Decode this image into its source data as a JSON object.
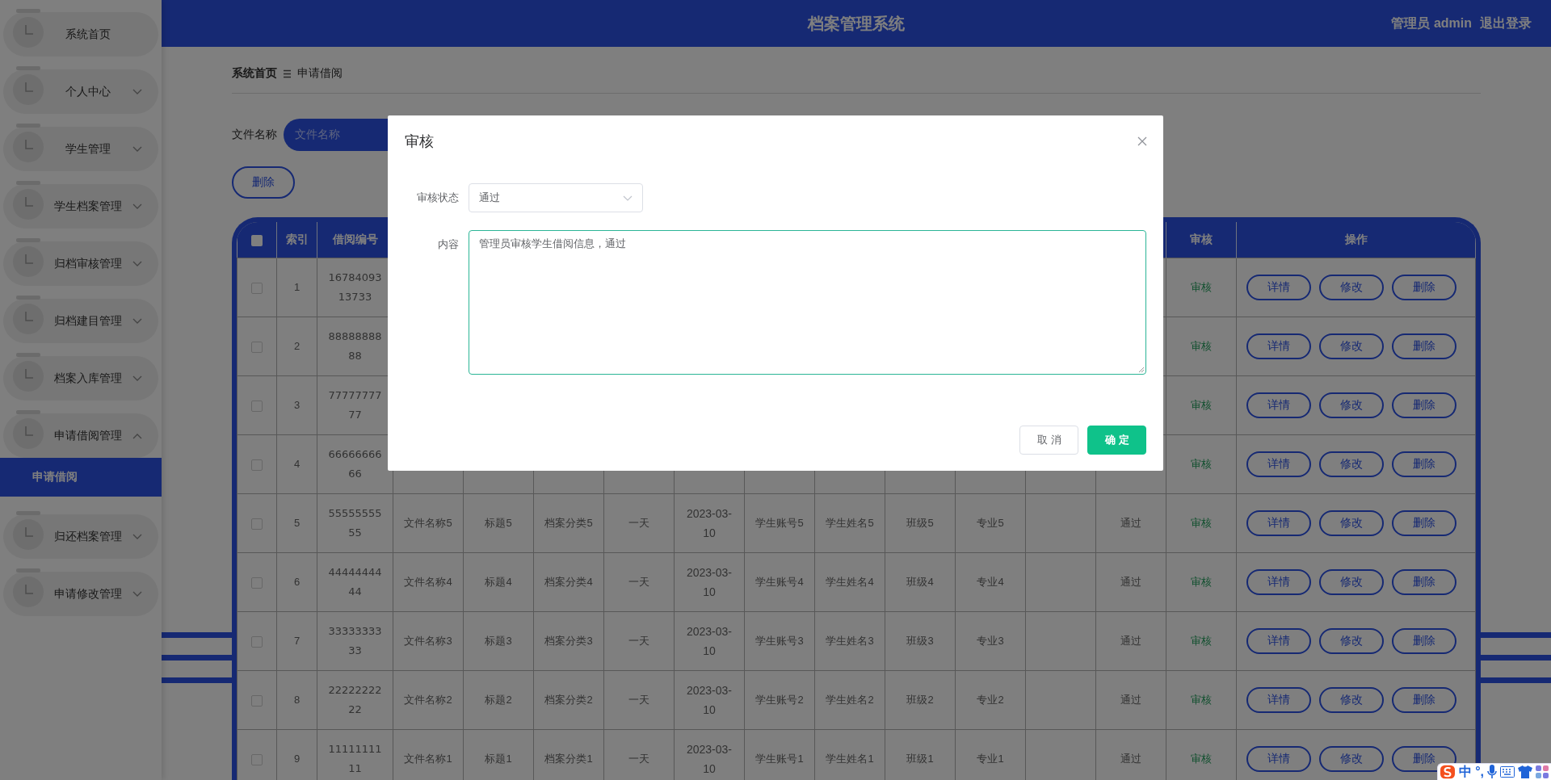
{
  "sidebar": {
    "items": [
      {
        "label": "系统首页",
        "has_children": false,
        "expanded": false
      },
      {
        "label": "个人中心",
        "has_children": true,
        "expanded": false
      },
      {
        "label": "学生管理",
        "has_children": true,
        "expanded": false
      },
      {
        "label": "学生档案管理",
        "has_children": true,
        "expanded": false
      },
      {
        "label": "归档审核管理",
        "has_children": true,
        "expanded": false
      },
      {
        "label": "归档建目管理",
        "has_children": true,
        "expanded": false
      },
      {
        "label": "档案入库管理",
        "has_children": true,
        "expanded": false
      },
      {
        "label": "申请借阅管理",
        "has_children": true,
        "expanded": true,
        "children": [
          {
            "label": "申请借阅",
            "selected": true
          }
        ]
      },
      {
        "label": "归还档案管理",
        "has_children": true,
        "expanded": false
      },
      {
        "label": "申请修改管理",
        "has_children": true,
        "expanded": false
      }
    ]
  },
  "header": {
    "title": "档案管理系统",
    "user": "管理员 admin",
    "logout": "退出登录"
  },
  "breadcrumb": [
    {
      "label": "系统首页",
      "current": false
    },
    {
      "label": "申请借阅",
      "current": true
    }
  ],
  "search": {
    "label": "文件名称",
    "placeholder": "文件名称"
  },
  "toolbar": {
    "delete_button": "删除"
  },
  "table": {
    "select_all": {
      "checked": false
    },
    "headers": {
      "index": "索引",
      "number": "借阅编号",
      "review": "审核",
      "actions": "操作"
    },
    "rows": [
      {
        "checked": false,
        "index": "1",
        "number": "1678409313733",
        "review": "审核",
        "actions": [
          "详情",
          "修改",
          "删除"
        ]
      },
      {
        "checked": false,
        "index": "2",
        "number": "8888888888",
        "review": "审核",
        "actions": [
          "详情",
          "修改",
          "删除"
        ]
      },
      {
        "checked": false,
        "index": "3",
        "number": "7777777777",
        "review": "审核",
        "actions": [
          "详情",
          "修改",
          "删除"
        ]
      },
      {
        "checked": false,
        "index": "4",
        "number": "6666666666",
        "review": "审核",
        "actions": [
          "详情",
          "修改",
          "删除"
        ]
      },
      {
        "checked": false,
        "index": "5",
        "number": "5555555555",
        "file_name": "文件名称5",
        "title": "标题5",
        "category": "档案分类5",
        "duration": "一天",
        "date": "2023-03-10",
        "account": "学生账号5",
        "student_name": "学生姓名5",
        "class": "班级5",
        "major": "专业5",
        "status": "通过",
        "review": "审核",
        "actions": [
          "详情",
          "修改",
          "删除"
        ]
      },
      {
        "checked": false,
        "index": "6",
        "number": "4444444444",
        "file_name": "文件名称4",
        "title": "标题4",
        "category": "档案分类4",
        "duration": "一天",
        "date": "2023-03-10",
        "account": "学生账号4",
        "student_name": "学生姓名4",
        "class": "班级4",
        "major": "专业4",
        "status": "通过",
        "review": "审核",
        "actions": [
          "详情",
          "修改",
          "删除"
        ]
      },
      {
        "checked": false,
        "index": "7",
        "number": "3333333333",
        "file_name": "文件名称3",
        "title": "标题3",
        "category": "档案分类3",
        "duration": "一天",
        "date": "2023-03-10",
        "account": "学生账号3",
        "student_name": "学生姓名3",
        "class": "班级3",
        "major": "专业3",
        "status": "通过",
        "review": "审核",
        "actions": [
          "详情",
          "修改",
          "删除"
        ]
      },
      {
        "checked": false,
        "index": "8",
        "number": "2222222222",
        "file_name": "文件名称2",
        "title": "标题2",
        "category": "档案分类2",
        "duration": "一天",
        "date": "2023-03-10",
        "account": "学生账号2",
        "student_name": "学生姓名2",
        "class": "班级2",
        "major": "专业2",
        "status": "通过",
        "review": "审核",
        "actions": [
          "详情",
          "修改",
          "删除"
        ]
      },
      {
        "checked": false,
        "index": "9",
        "number": "1111111111",
        "file_name": "文件名称1",
        "title": "标题1",
        "category": "档案分类1",
        "duration": "一天",
        "date": "2023-03-10",
        "account": "学生账号1",
        "student_name": "学生姓名1",
        "class": "班级1",
        "major": "专业1",
        "status": "通过",
        "review": "审核",
        "actions": [
          "详情",
          "修改",
          "删除"
        ]
      }
    ]
  },
  "dialog": {
    "title": "审核",
    "fields": [
      {
        "kind": "select",
        "label": "审核状态",
        "value": "通过",
        "focused": false
      },
      {
        "kind": "textarea",
        "label": "内容",
        "value": "管理员审核学生借阅信息，通过",
        "focused": true
      }
    ],
    "buttons": [
      {
        "kind": "default",
        "label": "取消"
      },
      {
        "kind": "primary",
        "label": "确定"
      }
    ]
  },
  "ime_toolbar": {
    "mode": "中",
    "punctuation": "°,"
  }
}
